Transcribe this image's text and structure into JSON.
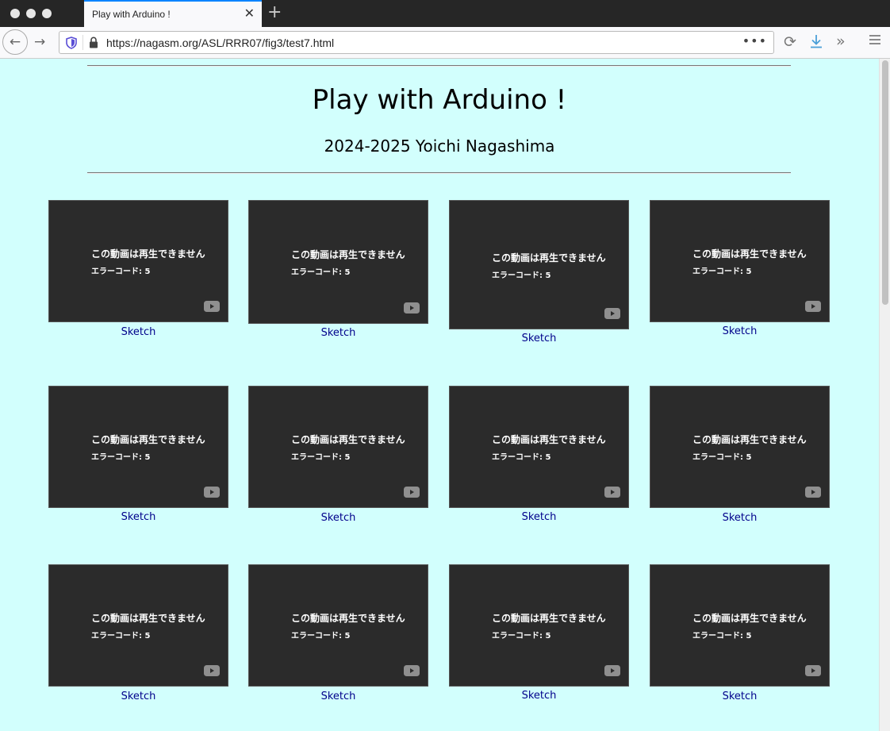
{
  "browser": {
    "tab_title": "Play with Arduino !",
    "tab_close": "✕",
    "new_tab": "+",
    "url": "https://nagasm.org/ASL/RRR07/fig3/test7.html",
    "url_more": "•••",
    "icons": [
      "back-arrow-icon",
      "forward-arrow-icon",
      "shield-icon",
      "lock-icon",
      "reload-icon",
      "download-icon",
      "overflow-icon",
      "hamburger-menu-icon"
    ]
  },
  "page": {
    "title": "Play with Arduino !",
    "subtitle": "2024-2025 Yoichi Nagashima",
    "background": "#d2fffd"
  },
  "videos": [
    {
      "message": "この動画は再生できません",
      "error": "エラーコード: 5",
      "link": "Sketch"
    },
    {
      "message": "この動画は再生できません",
      "error": "エラーコード: 5",
      "link": "Sketch"
    },
    {
      "message": "この動画は再生できません",
      "error": "エラーコード: 5",
      "link": "Sketch"
    },
    {
      "message": "この動画は再生できません",
      "error": "エラーコード: 5",
      "link": "Sketch"
    },
    {
      "message": "この動画は再生できません",
      "error": "エラーコード: 5",
      "link": "Sketch"
    },
    {
      "message": "この動画は再生できません",
      "error": "エラーコード: 5",
      "link": "Sketch"
    },
    {
      "message": "この動画は再生できません",
      "error": "エラーコード: 5",
      "link": "Sketch"
    },
    {
      "message": "この動画は再生できません",
      "error": "エラーコード: 5",
      "link": "Sketch"
    },
    {
      "message": "この動画は再生できません",
      "error": "エラーコード: 5",
      "link": "Sketch"
    },
    {
      "message": "この動画は再生できません",
      "error": "エラーコード: 5",
      "link": "Sketch"
    },
    {
      "message": "この動画は再生できません",
      "error": "エラーコード: 5",
      "link": "Sketch"
    },
    {
      "message": "この動画は再生できません",
      "error": "エラーコード: 5",
      "link": "Sketch"
    }
  ]
}
